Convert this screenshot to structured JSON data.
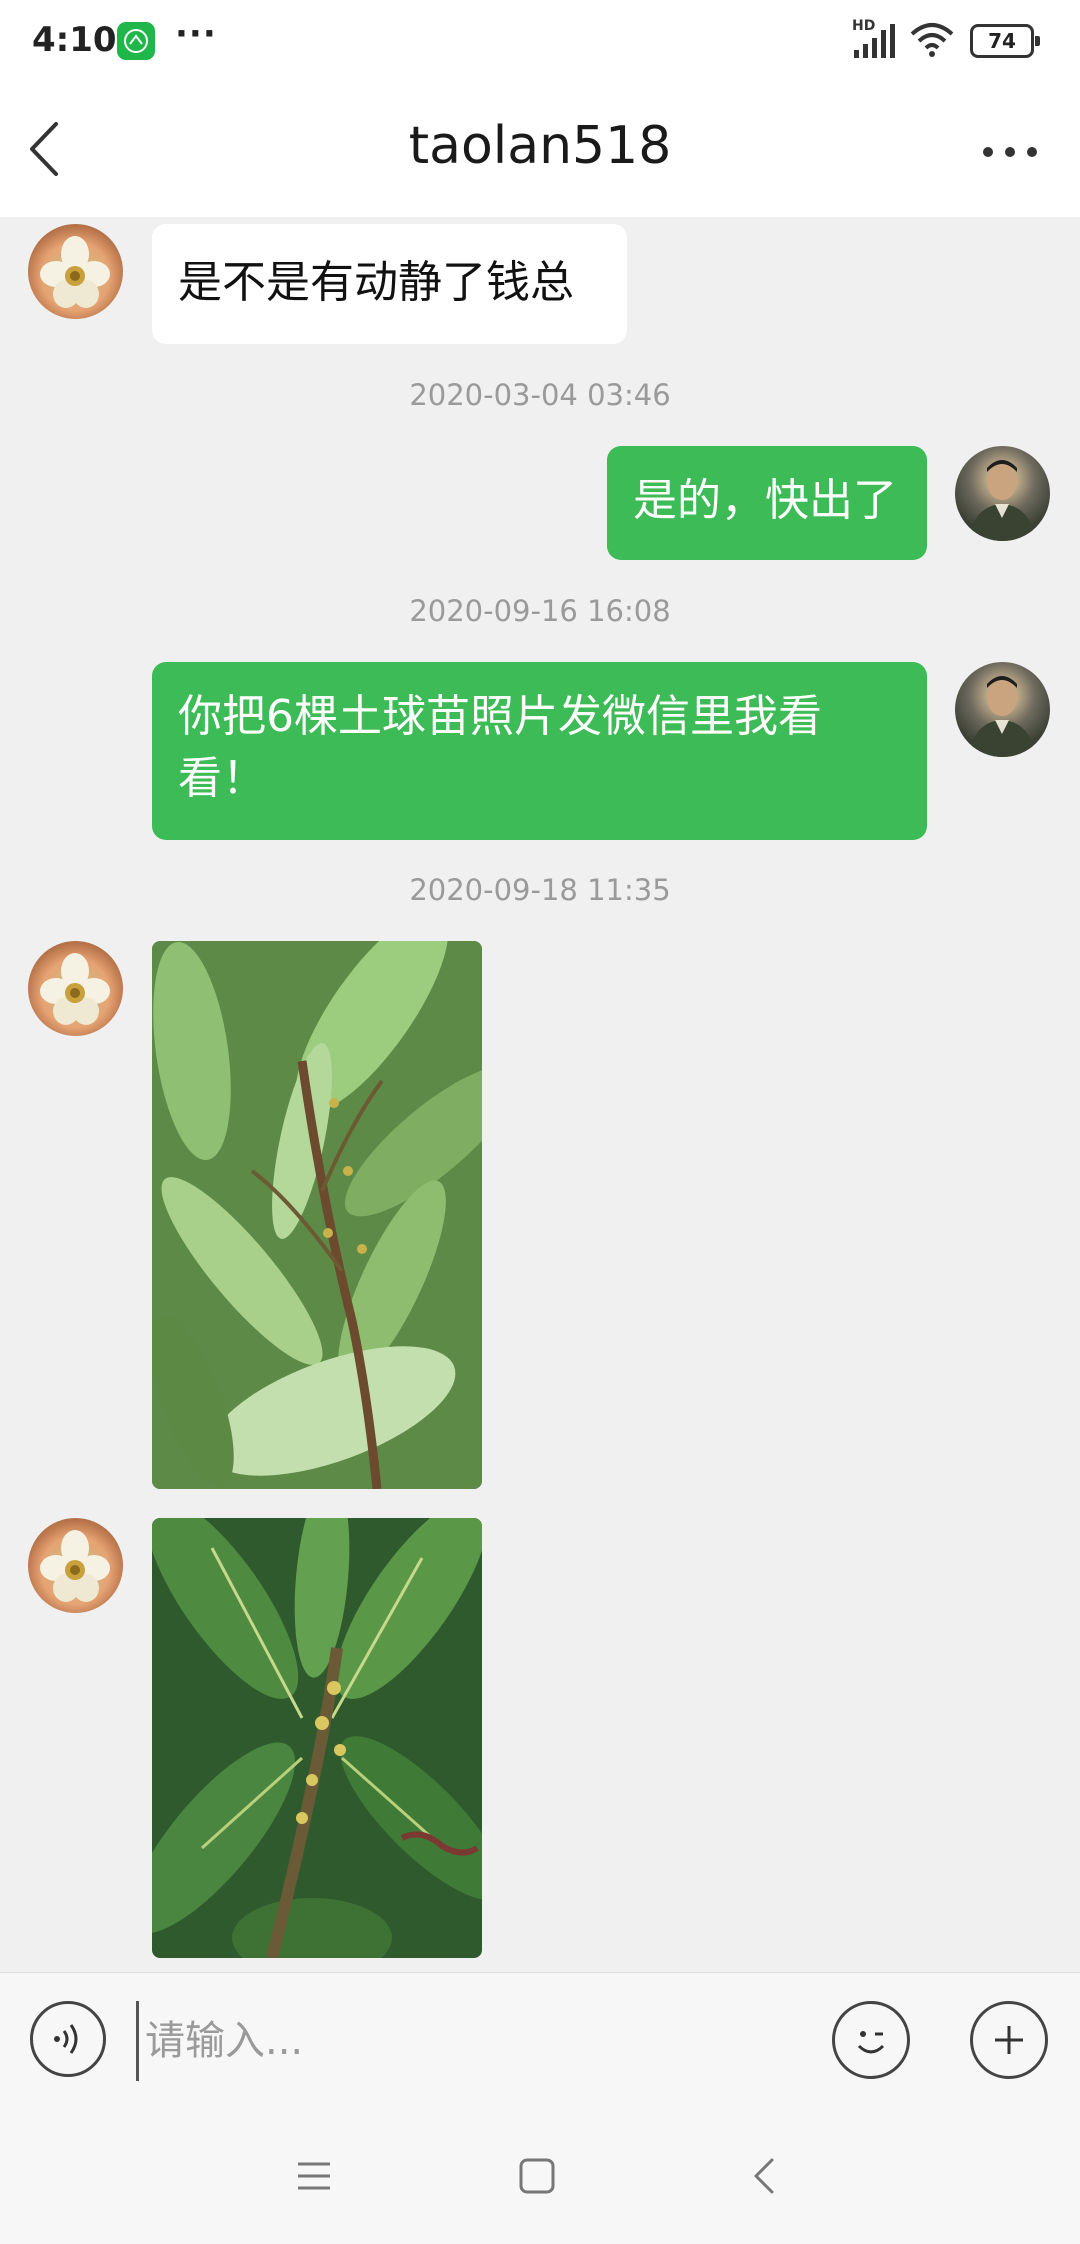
{
  "status_bar": {
    "time": "4:10",
    "more": "···",
    "signal_label": "HD",
    "battery": "74"
  },
  "header": {
    "title": "taolan518"
  },
  "messages": [
    {
      "type": "text",
      "direction": "in",
      "text": "是不是有动静了钱总"
    },
    {
      "type": "timestamp",
      "text": "2020-03-04 03:46"
    },
    {
      "type": "text",
      "direction": "out",
      "text": "是的，快出了"
    },
    {
      "type": "timestamp",
      "text": "2020-09-16 16:08"
    },
    {
      "type": "text",
      "direction": "out",
      "text": "你把6棵土球苗照片发微信里我看看！"
    },
    {
      "type": "timestamp",
      "text": "2020-09-18 11:35"
    },
    {
      "type": "image",
      "direction": "in"
    },
    {
      "type": "image",
      "direction": "in"
    }
  ],
  "input": {
    "placeholder": "请输入..."
  },
  "colors": {
    "outgoing_bubble": "#3cbb56",
    "incoming_bubble": "#ffffff",
    "background": "#f0f0f0"
  }
}
